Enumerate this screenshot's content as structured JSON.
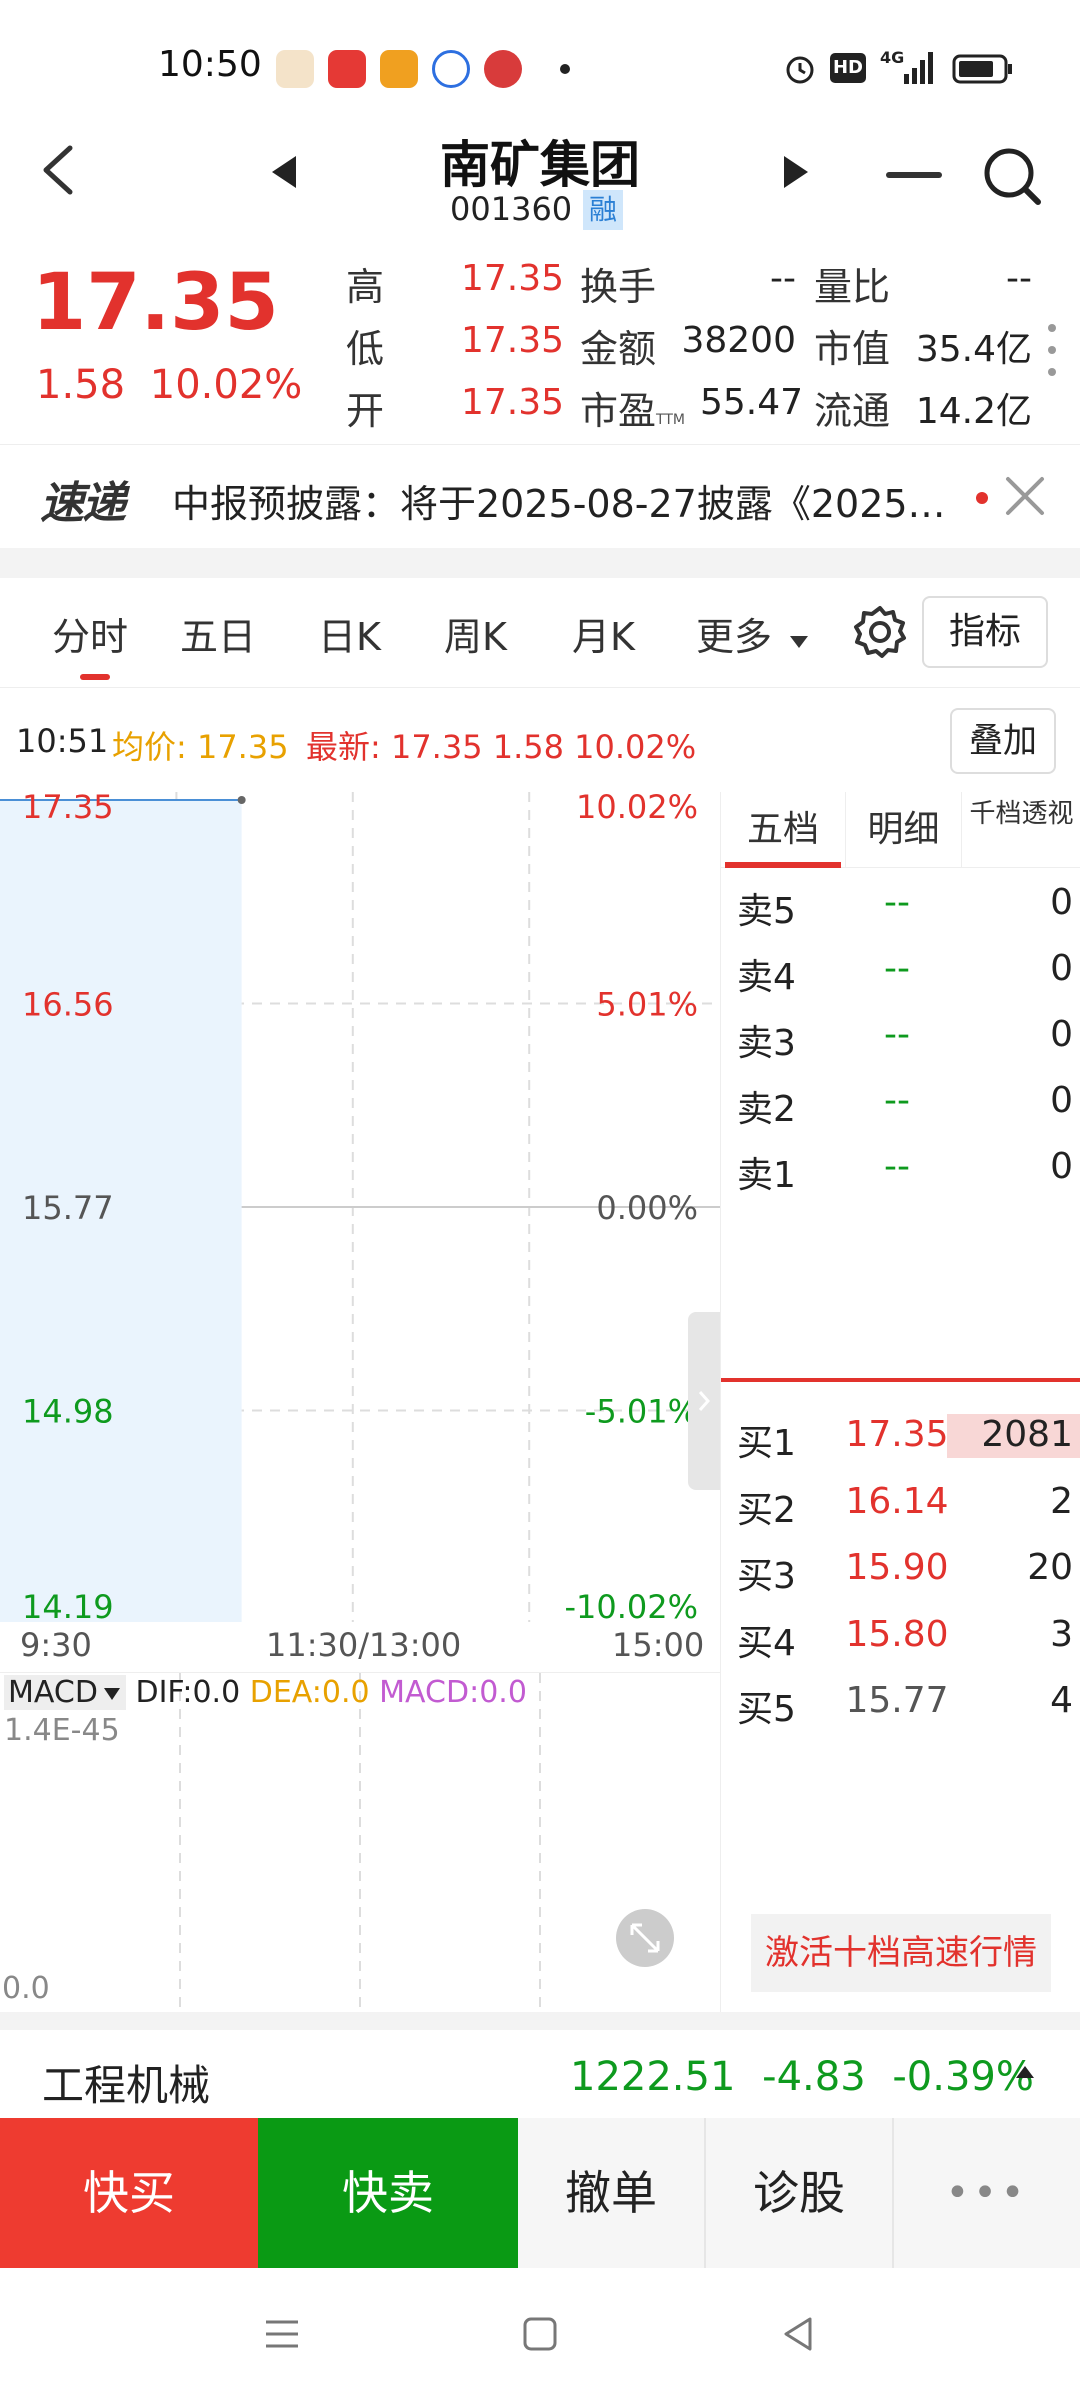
{
  "status_bar": {
    "time": "10:50",
    "network": "4G"
  },
  "header": {
    "stock_name": "南矿集团",
    "stock_code": "001360",
    "margin_badge": "融"
  },
  "quote": {
    "last_price": "17.35",
    "change": "1.58",
    "change_pct": "10.02%",
    "fields": {
      "high_label": "高",
      "high": "17.35",
      "low_label": "低",
      "low": "17.35",
      "open_label": "开",
      "open": "17.35",
      "turnover_label": "换手",
      "turnover": "--",
      "amount_label": "金额",
      "amount": "38200",
      "pe_label": "市盈",
      "pe_suffix": "TTM",
      "pe": "55.47",
      "volratio_label": "量比",
      "volratio": "--",
      "mktcap_label": "市值",
      "mktcap": "35.4亿",
      "float_label": "流通",
      "float": "14.2亿"
    }
  },
  "ticker": {
    "logo": "速递",
    "text": "中报预披露：将于2025-08-27披露《2025…"
  },
  "tabs": {
    "items": [
      "分时",
      "五日",
      "日K",
      "周K",
      "月K",
      "更多"
    ],
    "active": "分时",
    "indicator_label": "指标"
  },
  "info_line": {
    "time": "10:51",
    "avg": "均价: 17.35",
    "latest": "最新: 17.35 1.58 10.02%",
    "overlay_label": "叠加"
  },
  "chart_data": {
    "type": "line",
    "title": "",
    "x_range": [
      "9:30",
      "15:00"
    ],
    "x_ticks": [
      "9:30",
      "11:30/13:00",
      "15:00"
    ],
    "y_left_ticks": [
      "17.35",
      "16.56",
      "15.77",
      "14.98",
      "14.19"
    ],
    "y_right_ticks": [
      "10.02%",
      "5.01%",
      "0.00%",
      "-5.01%",
      "-10.02%"
    ],
    "ylim": [
      14.19,
      17.35
    ],
    "prev_close": 15.77,
    "series": [
      {
        "x": [
          "9:30",
          "10:51"
        ],
        "values": [
          17.35,
          17.35
        ]
      }
    ]
  },
  "macd": {
    "selector": "MACD",
    "dif": "DIF:0.0",
    "dea": "DEA:0.0",
    "macd": "MACD:0.0",
    "top_value": "1.4E-45",
    "bottom_value": "0.0"
  },
  "orderbook": {
    "tabs": [
      "五档",
      "明细",
      "千档透视"
    ],
    "active_tab": "五档",
    "asks": [
      {
        "label": "卖5",
        "price": "--",
        "volume": "0"
      },
      {
        "label": "卖4",
        "price": "--",
        "volume": "0"
      },
      {
        "label": "卖3",
        "price": "--",
        "volume": "0"
      },
      {
        "label": "卖2",
        "price": "--",
        "volume": "0"
      },
      {
        "label": "卖1",
        "price": "--",
        "volume": "0"
      }
    ],
    "bids": [
      {
        "label": "买1",
        "price": "17.35",
        "volume": "2081"
      },
      {
        "label": "买2",
        "price": "16.14",
        "volume": "2"
      },
      {
        "label": "买3",
        "price": "15.90",
        "volume": "20"
      },
      {
        "label": "买4",
        "price": "15.80",
        "volume": "3"
      },
      {
        "label": "买5",
        "price": "15.77",
        "volume": "4"
      }
    ],
    "activate_label": "激活十档高速行情"
  },
  "industry": {
    "name": "工程机械",
    "index": "1222.51",
    "change": "-4.83",
    "change_pct": "-0.39%"
  },
  "actions": {
    "buy": "快买",
    "sell": "快卖",
    "cancel": "撤单",
    "diagnose": "诊股",
    "more": "•••"
  },
  "colors": {
    "up": "#e2322d",
    "down": "#0e9a1e",
    "avg": "#e8a100",
    "line": "#4a8fd6",
    "fill": "#eaf4fd"
  }
}
